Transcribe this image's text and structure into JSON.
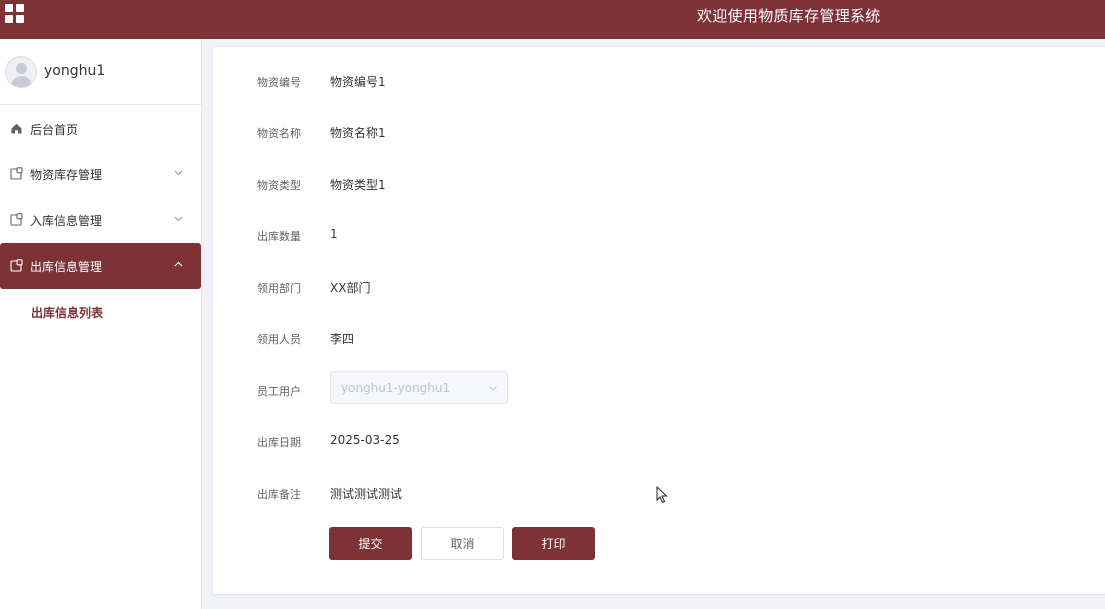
{
  "header": {
    "title": "欢迎使用物质库存管理系统",
    "menu_icon": "grid-icon",
    "background_color": "#7d3336"
  },
  "sidebar": {
    "user": {
      "name": "yonghu1",
      "avatar_icon": "user-avatar-icon"
    },
    "items": [
      {
        "label": "后台首页",
        "icon": "home-icon",
        "expanded": false,
        "active": false
      },
      {
        "label": "物资库存管理",
        "icon": "doc-icon",
        "expanded": false,
        "active": false
      },
      {
        "label": "入库信息管理",
        "icon": "doc-icon",
        "expanded": false,
        "active": false
      },
      {
        "label": "出库信息管理",
        "icon": "doc-icon",
        "expanded": true,
        "active": true
      }
    ],
    "subitems": [
      {
        "label": "出库信息列表",
        "active": true
      }
    ],
    "active_color": "#7d3336"
  },
  "form": {
    "fields": [
      {
        "label": "物资编号",
        "value": "物资编号1"
      },
      {
        "label": "物资名称",
        "value": "物资名称1"
      },
      {
        "label": "物资类型",
        "value": "物资类型1"
      },
      {
        "label": "出库数量",
        "value": "1"
      },
      {
        "label": "领用部门",
        "value": "XX部门"
      },
      {
        "label": "领用人员",
        "value": "李四"
      },
      {
        "label": "员工用户",
        "value": "yonghu1-yonghu1",
        "control": "select",
        "disabled": true
      },
      {
        "label": "出库日期",
        "value": "2025-03-25"
      },
      {
        "label": "出库备注",
        "value": "测试测试测试"
      }
    ],
    "buttons": {
      "submit": "提交",
      "cancel": "取消",
      "print": "打印"
    }
  }
}
